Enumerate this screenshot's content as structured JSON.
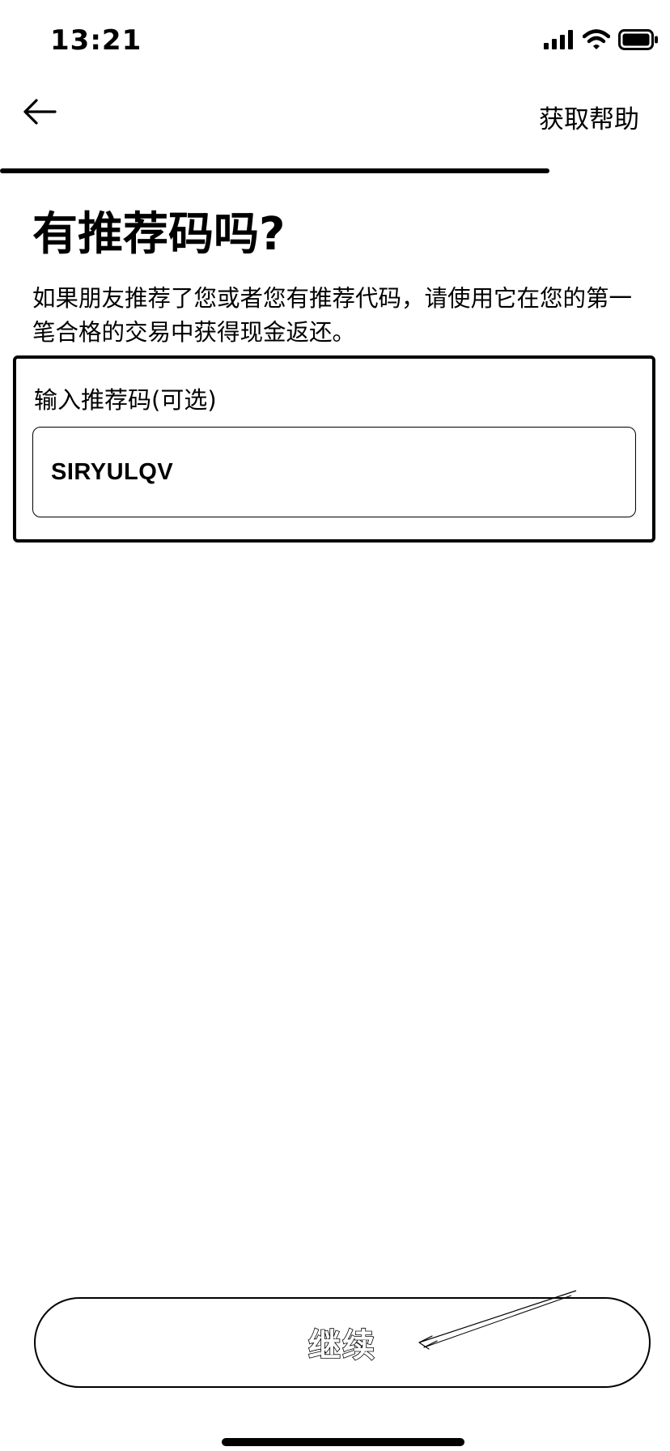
{
  "status_bar": {
    "time": "13:21",
    "icons": [
      "cellular-signal-icon",
      "wifi-icon",
      "battery-icon"
    ]
  },
  "nav": {
    "back_icon": "arrow-left-icon",
    "help_label": "获取帮助"
  },
  "progress": {
    "fraction": 0.82
  },
  "page": {
    "title": "有推荐码吗?",
    "description": "如果朋友推荐了您或者您有推荐代码，请使用它在您的第一笔合格的交易中获得现金返还。"
  },
  "referral_input": {
    "label": "输入推荐码(可选)",
    "value": "SIRYULQV"
  },
  "actions": {
    "continue_label": "继续"
  },
  "colors": {
    "foreground": "#000000",
    "background": "#ffffff"
  }
}
